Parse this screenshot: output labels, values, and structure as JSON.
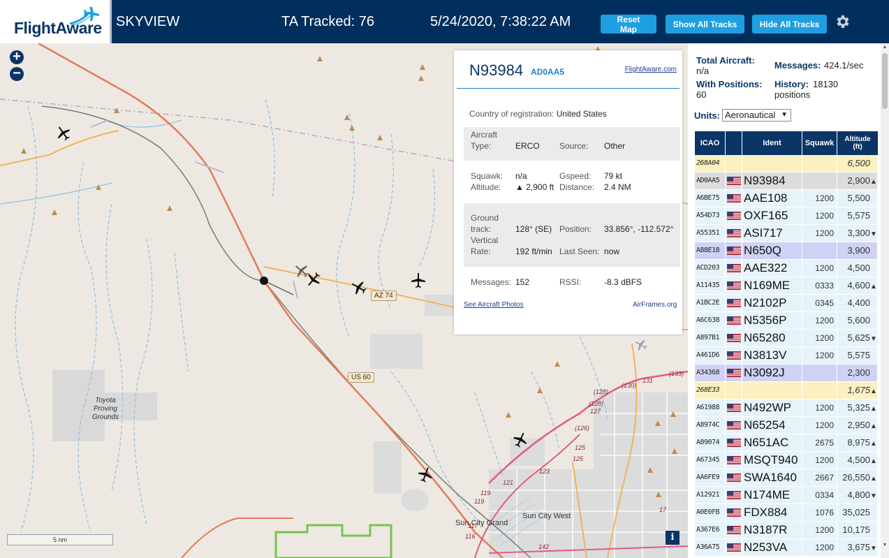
{
  "header": {
    "logo_text": "FlightAware",
    "title": "SKYVIEW",
    "tracked": "TA Tracked: 76",
    "timestamp": "5/24/2020, 7:38:22 AM",
    "reset_label": "Reset Map",
    "show_label": "Show All Tracks",
    "hide_label": "Hide All Tracks",
    "accent": "#1e9fe2",
    "bar_color": "#002f5d"
  },
  "map": {
    "zoom_in": "+",
    "zoom_out": "−",
    "scale": "5 nm",
    "info": "i",
    "road_labels": [
      "AZ 74",
      "US 60"
    ],
    "places": [
      "Toyota Proving Grounds",
      "Sun City Grand",
      "Sun City West"
    ],
    "route_numbers": [
      "(130)",
      "131",
      "(133)",
      "(128)",
      "(128)",
      "127",
      "(126)",
      "125",
      "125",
      "123",
      "121",
      "119",
      "119",
      "117",
      "116",
      "142",
      "17"
    ]
  },
  "popup": {
    "ident": "N93984",
    "icao": "AD0AA5",
    "fa_link": "FlightAware.com",
    "country_label": "Country of registration:",
    "country": "United States",
    "type_label_1": "Aircraft",
    "type_label_2": "Type:",
    "type": "ERCO",
    "source_label": "Source:",
    "source": "Other",
    "squawk_label": "Squawk:",
    "squawk": "n/a",
    "gspeed_label": "Gspeed:",
    "gspeed": "79 kt",
    "altitude_label": "Altitude:",
    "altitude": "▲ 2,900 ft",
    "distance_label": "Distance:",
    "distance": "2.4 NM",
    "track_label_1": "Ground",
    "track_label_2": "track:",
    "track": "128° (SE)",
    "position_label": "Position:",
    "position": "33.856°, -112.572°",
    "vrate_label_1": "Vertical",
    "vrate_label_2": "Rate:",
    "vrate": "192 ft/min",
    "lastseen_label": "Last Seen:",
    "lastseen": "now",
    "messages_label": "Messages:",
    "messages": "152",
    "rssi_label": "RSSI:",
    "rssi": "-8.3 dBFS",
    "photos_link": "See Aircraft Photos",
    "airframes_link": "AirFrames.org"
  },
  "sidebar": {
    "total_label": "Total Aircraft:",
    "total": "n/a",
    "messages_label": "Messages:",
    "messages": "424.1/sec",
    "positions_label": "With Positions:",
    "positions": "60",
    "history_label": "History:",
    "history": "18130",
    "history_unit": "positions",
    "units_label": "Units:",
    "units_value": "Aeronautical",
    "columns": [
      "ICAO",
      "Ident",
      "Squawk",
      "Altitude (ft)"
    ],
    "rows": [
      {
        "icao": "268A04",
        "flag": false,
        "ident": "",
        "squawk": "",
        "alt": "6,500",
        "trend": "",
        "state": "alert"
      },
      {
        "icao": "AD0AA5",
        "flag": true,
        "ident": "N93984",
        "squawk": "",
        "alt": "2,900",
        "trend": "▲",
        "state": "sel"
      },
      {
        "icao": "A6BE75",
        "flag": true,
        "ident": "AAE108",
        "squawk": "1200",
        "alt": "5,500",
        "trend": "",
        "state": ""
      },
      {
        "icao": "A54D73",
        "flag": true,
        "ident": "OXF165",
        "squawk": "1200",
        "alt": "5,575",
        "trend": "",
        "state": ""
      },
      {
        "icao": "A55351",
        "flag": true,
        "ident": "ASI717",
        "squawk": "1200",
        "alt": "3,300",
        "trend": "▼",
        "state": ""
      },
      {
        "icao": "A88E18",
        "flag": true,
        "ident": "N650Q",
        "squawk": "",
        "alt": "3,900",
        "trend": "",
        "state": "hl"
      },
      {
        "icao": "ACD203",
        "flag": true,
        "ident": "AAE322",
        "squawk": "1200",
        "alt": "4,500",
        "trend": "",
        "state": ""
      },
      {
        "icao": "A11435",
        "flag": true,
        "ident": "N169ME",
        "squawk": "0333",
        "alt": "4,600",
        "trend": "▲",
        "state": ""
      },
      {
        "icao": "A1BC2E",
        "flag": true,
        "ident": "N2102P",
        "squawk": "0345",
        "alt": "4,400",
        "trend": "",
        "state": ""
      },
      {
        "icao": "A6C638",
        "flag": true,
        "ident": "N5356P",
        "squawk": "1200",
        "alt": "5,600",
        "trend": "",
        "state": ""
      },
      {
        "icao": "A897B1",
        "flag": true,
        "ident": "N65280",
        "squawk": "1200",
        "alt": "5,625",
        "trend": "▼",
        "state": ""
      },
      {
        "icao": "A461D6",
        "flag": true,
        "ident": "N3813V",
        "squawk": "1200",
        "alt": "5,575",
        "trend": "",
        "state": ""
      },
      {
        "icao": "A34368",
        "flag": true,
        "ident": "N3092J",
        "squawk": "",
        "alt": "2,300",
        "trend": "",
        "state": "hl"
      },
      {
        "icao": "268E33",
        "flag": false,
        "ident": "",
        "squawk": "",
        "alt": "1,675",
        "trend": "▲",
        "state": "alert"
      },
      {
        "icao": "A61988",
        "flag": true,
        "ident": "N492WP",
        "squawk": "1200",
        "alt": "5,325",
        "trend": "▲",
        "state": ""
      },
      {
        "icao": "A8974C",
        "flag": true,
        "ident": "N65254",
        "squawk": "1200",
        "alt": "2,950",
        "trend": "▲",
        "state": ""
      },
      {
        "icao": "A89074",
        "flag": true,
        "ident": "N651AC",
        "squawk": "2675",
        "alt": "8,975",
        "trend": "▲",
        "state": ""
      },
      {
        "icao": "A67345",
        "flag": true,
        "ident": "MSQT940",
        "squawk": "1200",
        "alt": "4,500",
        "trend": "▲",
        "state": ""
      },
      {
        "icao": "AA6FE9",
        "flag": true,
        "ident": "SWA1640",
        "squawk": "2667",
        "alt": "26,550",
        "trend": "▲",
        "state": ""
      },
      {
        "icao": "A12921",
        "flag": true,
        "ident": "N174ME",
        "squawk": "0334",
        "alt": "4,800",
        "trend": "▼",
        "state": ""
      },
      {
        "icao": "A0E0FB",
        "flag": true,
        "ident": "FDX884",
        "squawk": "1076",
        "alt": "35,025",
        "trend": "",
        "state": ""
      },
      {
        "icao": "A367E6",
        "flag": true,
        "ident": "N3187R",
        "squawk": "1200",
        "alt": "10,175",
        "trend": "",
        "state": ""
      },
      {
        "icao": "A36A75",
        "flag": true,
        "ident": "N253VA",
        "squawk": "1200",
        "alt": "3,675",
        "trend": "▼",
        "state": ""
      }
    ]
  }
}
